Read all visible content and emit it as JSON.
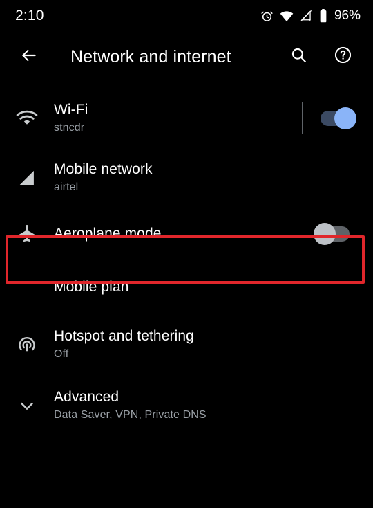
{
  "status_bar": {
    "clock": "2:10",
    "battery_percent": "96%",
    "icons": [
      "alarm-icon",
      "wifi-icon",
      "cellular-signal-off-icon",
      "battery-icon"
    ]
  },
  "app_bar": {
    "back_icon": "back-arrow-icon",
    "title": "Network and internet",
    "search_icon": "search-icon",
    "help_icon": "help-circle-icon"
  },
  "colors": {
    "background": "#000000",
    "primary_text": "#ffffff",
    "secondary_text": "#9aa0a6",
    "toggle_on_thumb": "#8ab4f8",
    "toggle_on_track": "#3b4a63",
    "toggle_off_thumb": "#bdc1c6",
    "toggle_off_track": "#5f6368",
    "highlight_border": "#e0262b"
  },
  "settings_rows": [
    {
      "id": "wifi",
      "icon": "wifi-icon",
      "title": "Wi-Fi",
      "subtitle": "stncdr",
      "toggle": "on",
      "divider": true
    },
    {
      "id": "mobile-network",
      "icon": "cellular-signal-icon",
      "title": "Mobile network",
      "subtitle": "airtel",
      "toggle": null,
      "divider": false
    },
    {
      "id": "aeroplane-mode",
      "icon": "airplane-icon",
      "title": "Aeroplane mode",
      "subtitle": "",
      "toggle": "off",
      "divider": false,
      "highlighted": true
    },
    {
      "id": "mobile-plan",
      "icon": "",
      "title": "Mobile plan",
      "subtitle": "",
      "toggle": null,
      "divider": false
    },
    {
      "id": "hotspot-tethering",
      "icon": "hotspot-icon",
      "title": "Hotspot and tethering",
      "subtitle": "Off",
      "toggle": null,
      "divider": false
    },
    {
      "id": "advanced",
      "icon": "chevron-down-icon",
      "title": "Advanced",
      "subtitle": "Data Saver, VPN, Private DNS",
      "toggle": null,
      "divider": false
    }
  ]
}
